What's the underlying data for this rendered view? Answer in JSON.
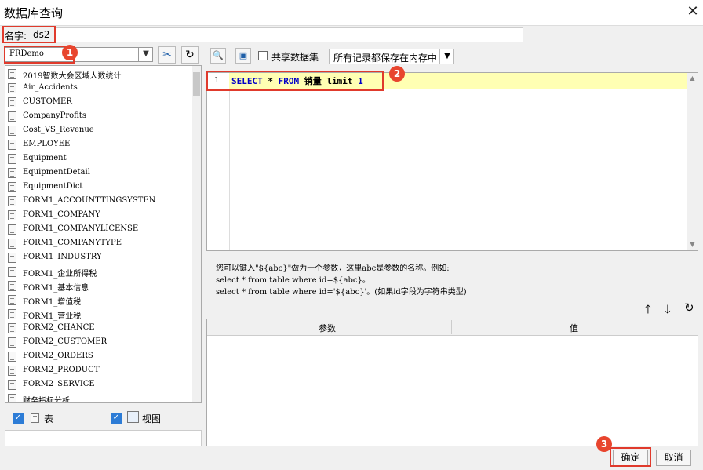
{
  "window": {
    "title": "数据库查询",
    "close": "✕"
  },
  "name_field": {
    "label": "名字:",
    "value": "ds2"
  },
  "datasource": {
    "selected": "FRDemo"
  },
  "tables": [
    "2019智数大会区域人数统计",
    "Air_Accidents",
    "CUSTOMER",
    "CompanyProfits",
    "Cost_VS_Revenue",
    "EMPLOYEE",
    "Equipment",
    "EquipmentDetail",
    "EquipmentDict",
    "FORM1_ACCOUNTTINGSYSTEN",
    "FORM1_COMPANY",
    "FORM1_COMPANYLICENSE",
    "FORM1_COMPANYTYPE",
    "FORM1_INDUSTRY",
    "FORM1_企业所得税",
    "FORM1_基本信息",
    "FORM1_增值税",
    "FORM1_营业税",
    "FORM2_CHANCE",
    "FORM2_CUSTOMER",
    "FORM2_ORDERS",
    "FORM2_PRODUCT",
    "FORM2_SERVICE",
    "财务指标分析"
  ],
  "filters": {
    "table_label": "表",
    "view_label": "视图"
  },
  "toolbar": {
    "share_label": "共享数据集",
    "memory_option": "所有记录都保存在内存中"
  },
  "editor": {
    "line_number": "1",
    "sql": {
      "kw1": "SELECT",
      "star": " * ",
      "kw2": "FROM",
      "rest": " 销量 limit ",
      "num": "1"
    }
  },
  "help": {
    "line1": "您可以键入\"${abc}\"做为一个参数，这里abc是参数的名称。例如:",
    "line2": "select * from table where id=${abc}。",
    "line3": "select * from table where id='${abc}'。(如果id字段为字符串类型)"
  },
  "params": {
    "col_param": "参数",
    "col_value": "值"
  },
  "buttons": {
    "ok": "确定",
    "cancel": "取消"
  },
  "badges": [
    "1",
    "2",
    "3"
  ],
  "colors": {
    "highlight": "#ffffb3",
    "keyword": "#0000c8",
    "callout": "#e8452e"
  }
}
